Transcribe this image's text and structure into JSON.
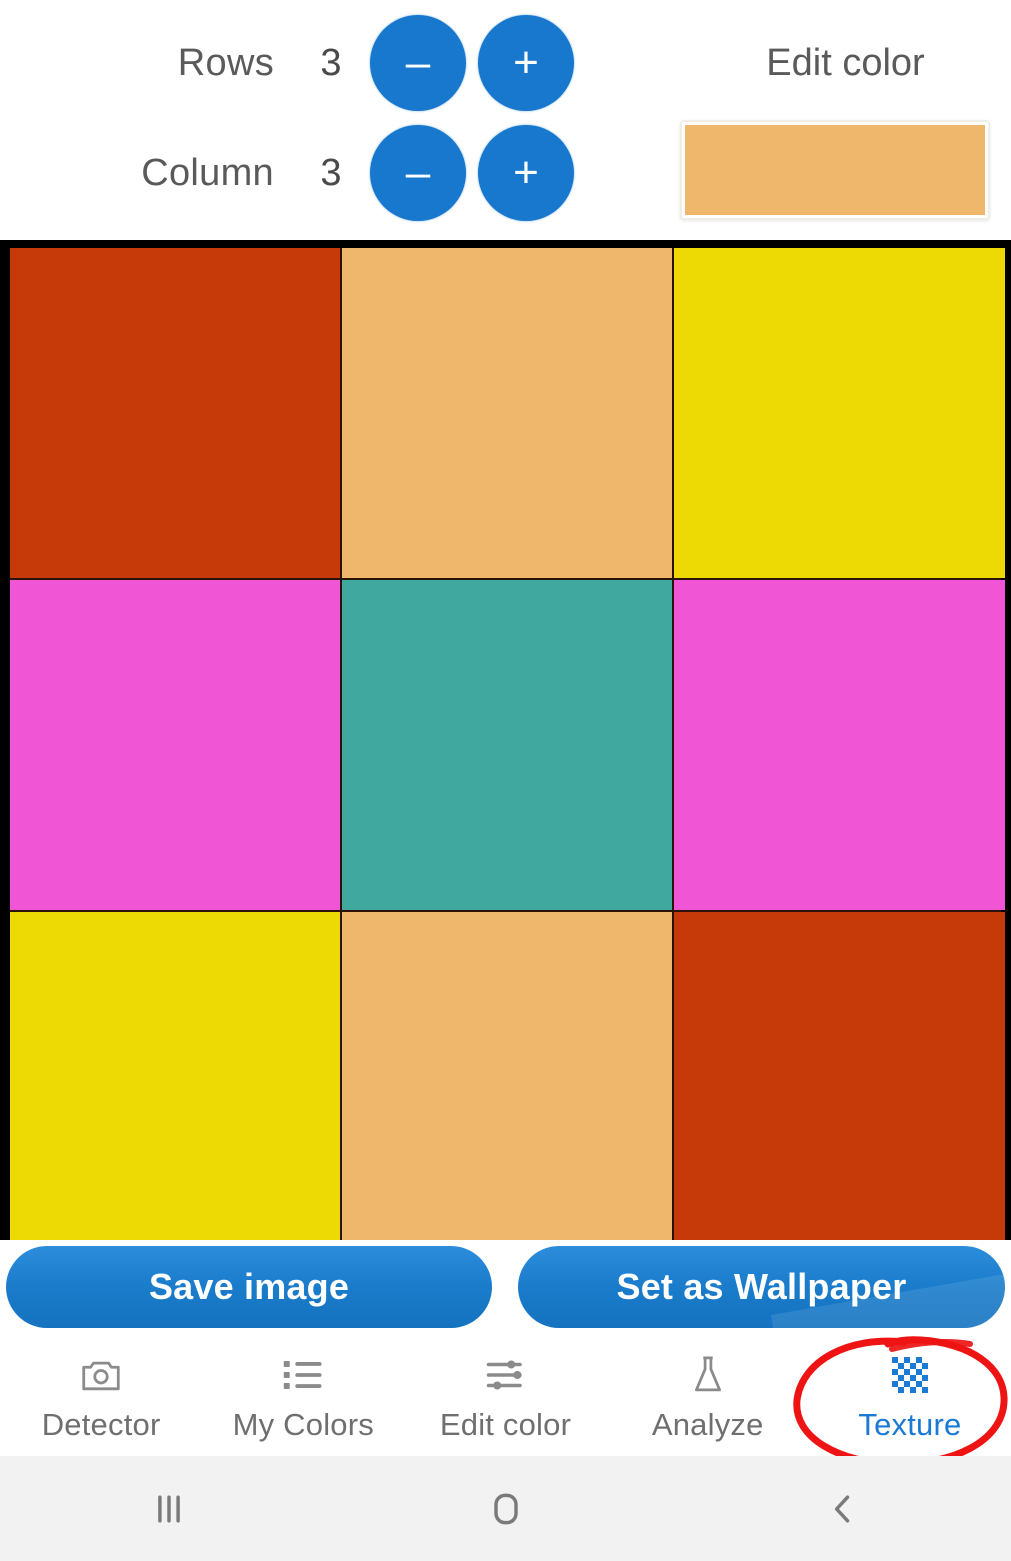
{
  "controls": {
    "rows": {
      "label": "Rows",
      "value": "3",
      "minus_label": "–",
      "plus_label": "+"
    },
    "columns": {
      "label": "Column",
      "value": "3",
      "minus_label": "–",
      "plus_label": "+"
    },
    "edit_color_title": "Edit color",
    "selected_color": "#eeb76b"
  },
  "texture_grid": {
    "rows": 3,
    "columns": 3,
    "palette": {
      "rust": "#c53a08",
      "peach": "#eeb76b",
      "yellow": "#edda05",
      "pink": "#f055d6",
      "teal": "#41a8a0"
    },
    "cells": [
      {
        "name": "cell-r1c1",
        "color": "#c53a08"
      },
      {
        "name": "cell-r1c2",
        "color": "#eeb76b"
      },
      {
        "name": "cell-r1c3",
        "color": "#edda05"
      },
      {
        "name": "cell-r2c1",
        "color": "#f055d6"
      },
      {
        "name": "cell-r2c2",
        "color": "#41a8a0"
      },
      {
        "name": "cell-r2c3",
        "color": "#f055d6"
      },
      {
        "name": "cell-r3c1",
        "color": "#edda05"
      },
      {
        "name": "cell-r3c2",
        "color": "#eeb76b"
      },
      {
        "name": "cell-r3c3",
        "color": "#c53a08"
      }
    ]
  },
  "actions": {
    "save_label": "Save image",
    "wallpaper_label": "Set as Wallpaper",
    "button_color": "#1a7ccb"
  },
  "bottom_nav": {
    "active_color": "#1a7ad4",
    "inactive_color": "#6f6f6f",
    "items": [
      {
        "label": "Detector",
        "icon": "camera-icon",
        "active": false
      },
      {
        "label": "My Colors",
        "icon": "list-icon",
        "active": false
      },
      {
        "label": "Edit color",
        "icon": "sliders-icon",
        "active": false
      },
      {
        "label": "Analyze",
        "icon": "flask-icon",
        "active": false
      },
      {
        "label": "Texture",
        "icon": "checkerboard-icon",
        "active": true
      }
    ]
  },
  "annotation": {
    "type": "hand-drawn-ellipse",
    "color": "#ee1414",
    "target": "Texture"
  },
  "system_bar": {
    "recents_label": "Recents",
    "home_label": "Home",
    "back_label": "Back"
  }
}
